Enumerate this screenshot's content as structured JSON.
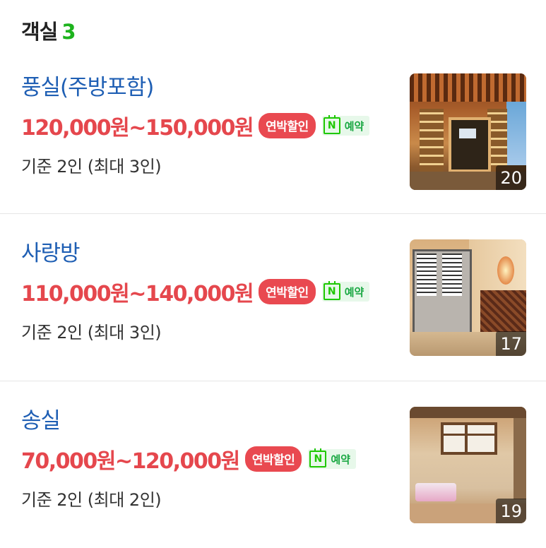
{
  "header": {
    "title": "객실",
    "count": "3"
  },
  "rooms": [
    {
      "name": "풍실(주방포함)",
      "price": "120,000원~150,000원",
      "discount_label": "연박할인",
      "naver_label": "예약",
      "capacity": "기준 2인 (최대 3인)",
      "photo_count": "20"
    },
    {
      "name": "사랑방",
      "price": "110,000원~140,000원",
      "discount_label": "연박할인",
      "naver_label": "예약",
      "capacity": "기준 2인 (최대 3인)",
      "photo_count": "17"
    },
    {
      "name": "송실",
      "price": "70,000원~120,000원",
      "discount_label": "연박할인",
      "naver_label": "예약",
      "capacity": "기준 2인 (최대 2인)",
      "photo_count": "19"
    }
  ],
  "icons": {
    "naver_booking": "naver-calendar-icon"
  },
  "colors": {
    "accent_count": "#1db31d",
    "room_name": "#1f5fb4",
    "price": "#e5474d",
    "discount_badge": "#e94950",
    "naver_green": "#1ec800"
  }
}
